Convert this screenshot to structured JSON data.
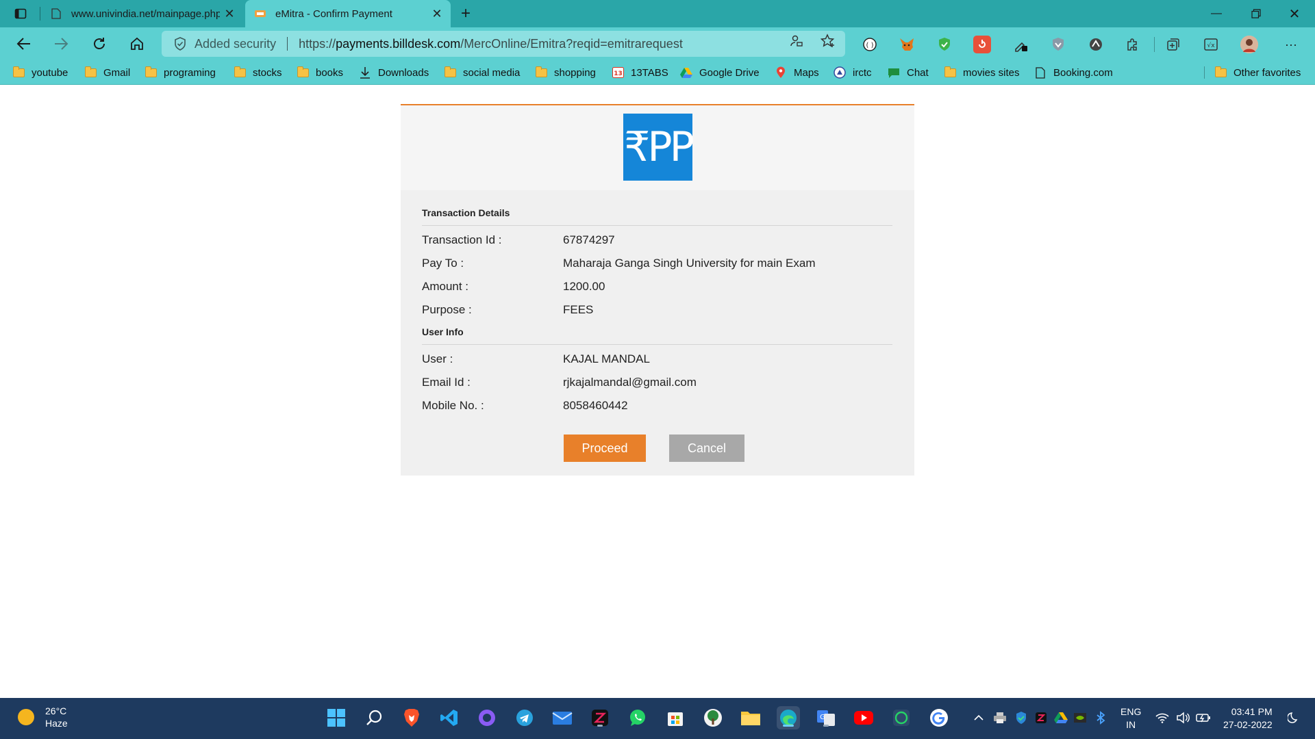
{
  "browser": {
    "tabs": [
      {
        "title": "www.univindia.net/mainpage.php",
        "active": false
      },
      {
        "title": "eMitra - Confirm Payment",
        "active": true
      }
    ],
    "address": {
      "security_label": "Added security",
      "url_prefix": "https://",
      "url_host": "payments.billdesk.com",
      "url_path": "/MercOnline/Emitra?reqid=emitrarequest"
    },
    "bookmarks": [
      {
        "label": "youtube",
        "icon": "folder-icon"
      },
      {
        "label": "Gmail",
        "icon": "folder-icon"
      },
      {
        "label": "programing",
        "icon": "folder-icon"
      },
      {
        "label": "stocks",
        "icon": "folder-icon"
      },
      {
        "label": "books",
        "icon": "folder-icon"
      },
      {
        "label": "Downloads",
        "icon": "download-icon"
      },
      {
        "label": "social media",
        "icon": "folder-icon"
      },
      {
        "label": "shopping",
        "icon": "folder-icon"
      },
      {
        "label": "13TABS",
        "icon": "13tabs-icon"
      },
      {
        "label": "Google Drive",
        "icon": "google-drive-icon"
      },
      {
        "label": "Maps",
        "icon": "maps-icon"
      },
      {
        "label": "irctc",
        "icon": "irctc-icon"
      },
      {
        "label": "Chat",
        "icon": "chat-icon"
      },
      {
        "label": "movies sites",
        "icon": "folder-icon"
      },
      {
        "label": "Booking.com",
        "icon": "page-icon"
      },
      {
        "label": "Other favorites",
        "icon": "folder-icon"
      }
    ]
  },
  "payment": {
    "logo_text": "₹PP",
    "transaction_section_title": "Transaction Details",
    "transaction_rows": [
      {
        "label": "Transaction Id :",
        "value": "67874297"
      },
      {
        "label": "Pay To :",
        "value": "Maharaja Ganga Singh University for main Exam"
      },
      {
        "label": "Amount :",
        "value": "1200.00"
      },
      {
        "label": "Purpose :",
        "value": "FEES"
      }
    ],
    "user_section_title": "User Info",
    "user_rows": [
      {
        "label": "User :",
        "value": "KAJAL MANDAL"
      },
      {
        "label": "Email Id :",
        "value": "rjkajalmandal@gmail.com"
      },
      {
        "label": "Mobile No. :",
        "value": "8058460442"
      }
    ],
    "proceed_label": "Proceed",
    "cancel_label": "Cancel",
    "colors": {
      "accent": "#e8802a",
      "logo_blue": "#1586d8",
      "cancel_gray": "#a8a8a8"
    }
  },
  "taskbar": {
    "weather_temp": "26°C",
    "weather_desc": "Haze",
    "lang_line1": "ENG",
    "lang_line2": "IN",
    "time": "03:41 PM",
    "date": "27-02-2022"
  }
}
